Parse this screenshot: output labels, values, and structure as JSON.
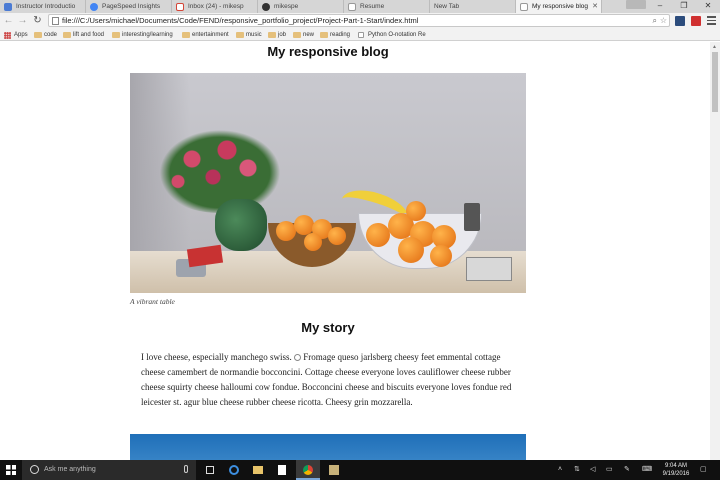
{
  "tabs": [
    {
      "label": "Instructor Introductio",
      "color": "#4b7bd4"
    },
    {
      "label": "PageSpeed Insights",
      "color": "#4285f4"
    },
    {
      "label": "Inbox (24) - mikesp",
      "color": "#d44638"
    },
    {
      "label": "mikespe",
      "color": "#333333"
    },
    {
      "label": "Resume",
      "color": "#f2f2f2"
    },
    {
      "label": "New Tab",
      "color": "#f2f2f2"
    },
    {
      "label": "My responsive blog",
      "color": "#f2f2f2"
    }
  ],
  "toolbar": {
    "url": "file:///C:/Users/michael/Documents/Code/FEND/responsive_portfolio_project/Project-Part-1-Start/index.html"
  },
  "bookmarks": [
    {
      "label": "Apps",
      "kind": "apps"
    },
    {
      "label": "code",
      "kind": "folder"
    },
    {
      "label": "lift and food",
      "kind": "folder"
    },
    {
      "label": "interesting/learning",
      "kind": "folder"
    },
    {
      "label": "entertainment",
      "kind": "folder"
    },
    {
      "label": "music",
      "kind": "folder"
    },
    {
      "label": "job",
      "kind": "folder"
    },
    {
      "label": "new",
      "kind": "folder"
    },
    {
      "label": "reading",
      "kind": "folder"
    },
    {
      "label": "Python O-notation Re",
      "kind": "page"
    }
  ],
  "page": {
    "title": "My responsive blog",
    "caption": "A vibrant table",
    "story_title": "My story",
    "story_part1": "I love cheese, especially manchego swiss.",
    "story_part2": "Fromage queso jarlsberg cheesy feet emmental cottage cheese camembert de normandie bocconcini. Cottage cheese everyone loves cauliflower cheese rubber cheese squirty cheese halloumi cow fondue. Bocconcini cheese and biscuits everyone loves fondue red leicester st. agur blue cheese rubber cheese ricotta. Cheesy grin mozzarella."
  },
  "taskbar": {
    "search_placeholder": "Ask me anything",
    "time": "9:04 AM",
    "date": "9/19/2016"
  }
}
